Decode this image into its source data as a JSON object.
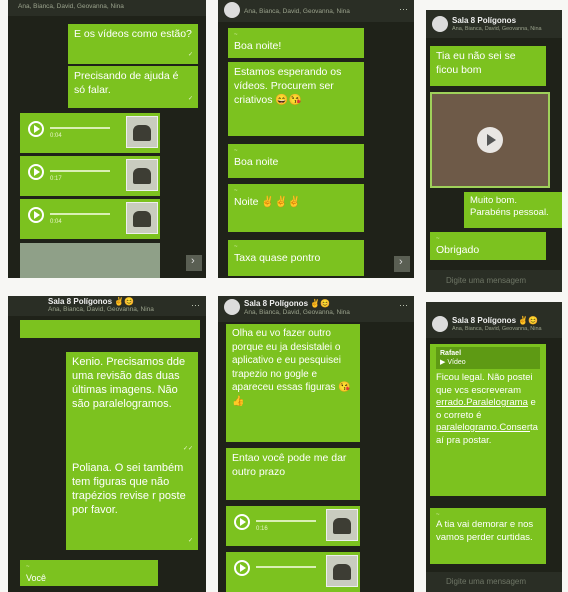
{
  "p1": {
    "members": "Ana, Bianca, David, Geovanna, Nina",
    "msg1": "E os vídeos como estão?",
    "msg2": "Precisando de ajuda é só falar.",
    "audios": [
      {
        "dur": "0:04"
      },
      {
        "dur": "0:17"
      },
      {
        "dur": "0:04"
      }
    ]
  },
  "p2": {
    "members": "Ana, Bianca, David, Geovanna, Nina",
    "msg1": "Boa noite!",
    "msg2": "Estamos esperando os vídeos. Procurem ser criativos 😄😘",
    "msg3": "Boa noite",
    "msg4": "Noite ✌✌✌",
    "msg5": "Taxa quase pontro"
  },
  "p3": {
    "group": "Sala 8 Polígonos",
    "members": "Ana, Bianca, David, Geovanna, Nina",
    "msg1": "Tia eu não sei se ficou bom",
    "msg2": "Muito bom. Parabéns pessoal.",
    "msg3": "Obrigado",
    "placeholder": "Digite uma mensagem"
  },
  "p4": {
    "group": "Sala 8 Polígonos ✌😊",
    "members": "Ana, Bianca, David, Geovanna, Nina",
    "msg1": "Kenio. Precisamos dde uma revisão das duas últimas imagens. Não são paralelogramos.",
    "msg2": "Poliana. O sei também tem figuras que não trapézios revise r poste por favor.",
    "msg3": "Você"
  },
  "p5": {
    "group": "Sala 8 Polígonos ✌😊",
    "members": "Ana, Bianca, David, Geovanna, Nina",
    "msg1": "Olha eu vo fazer outro porque eu ja desistalei o aplicativo e eu pesquisei trapezio no gogle e apareceu essas figuras 😘👍",
    "msg2": "Entao você pode me dar outro prazo",
    "audio_dur": "0:16"
  },
  "p6": {
    "group": "Sala 8 Polígonos ✌😊",
    "members": "Ana, Bianca, David, Geovanna, Nina",
    "reply_name": "Rafael",
    "reply_type": "Vídeo",
    "msg1_pre": "Ficou legal. Não postei que vcs escreveram ",
    "msg1_link1": "errado.Paralelograma",
    "msg1_mid": " e o correto é ",
    "msg1_link2": "paralelogramo.Conser",
    "msg1_post": "ta aí pra postar.",
    "msg2": "A tia vai demorar e nos vamos perder curtidas.",
    "placeholder": "Digite uma mensagem"
  },
  "colors": {
    "bubble": "#7cc21f",
    "background": "#1f2219"
  }
}
